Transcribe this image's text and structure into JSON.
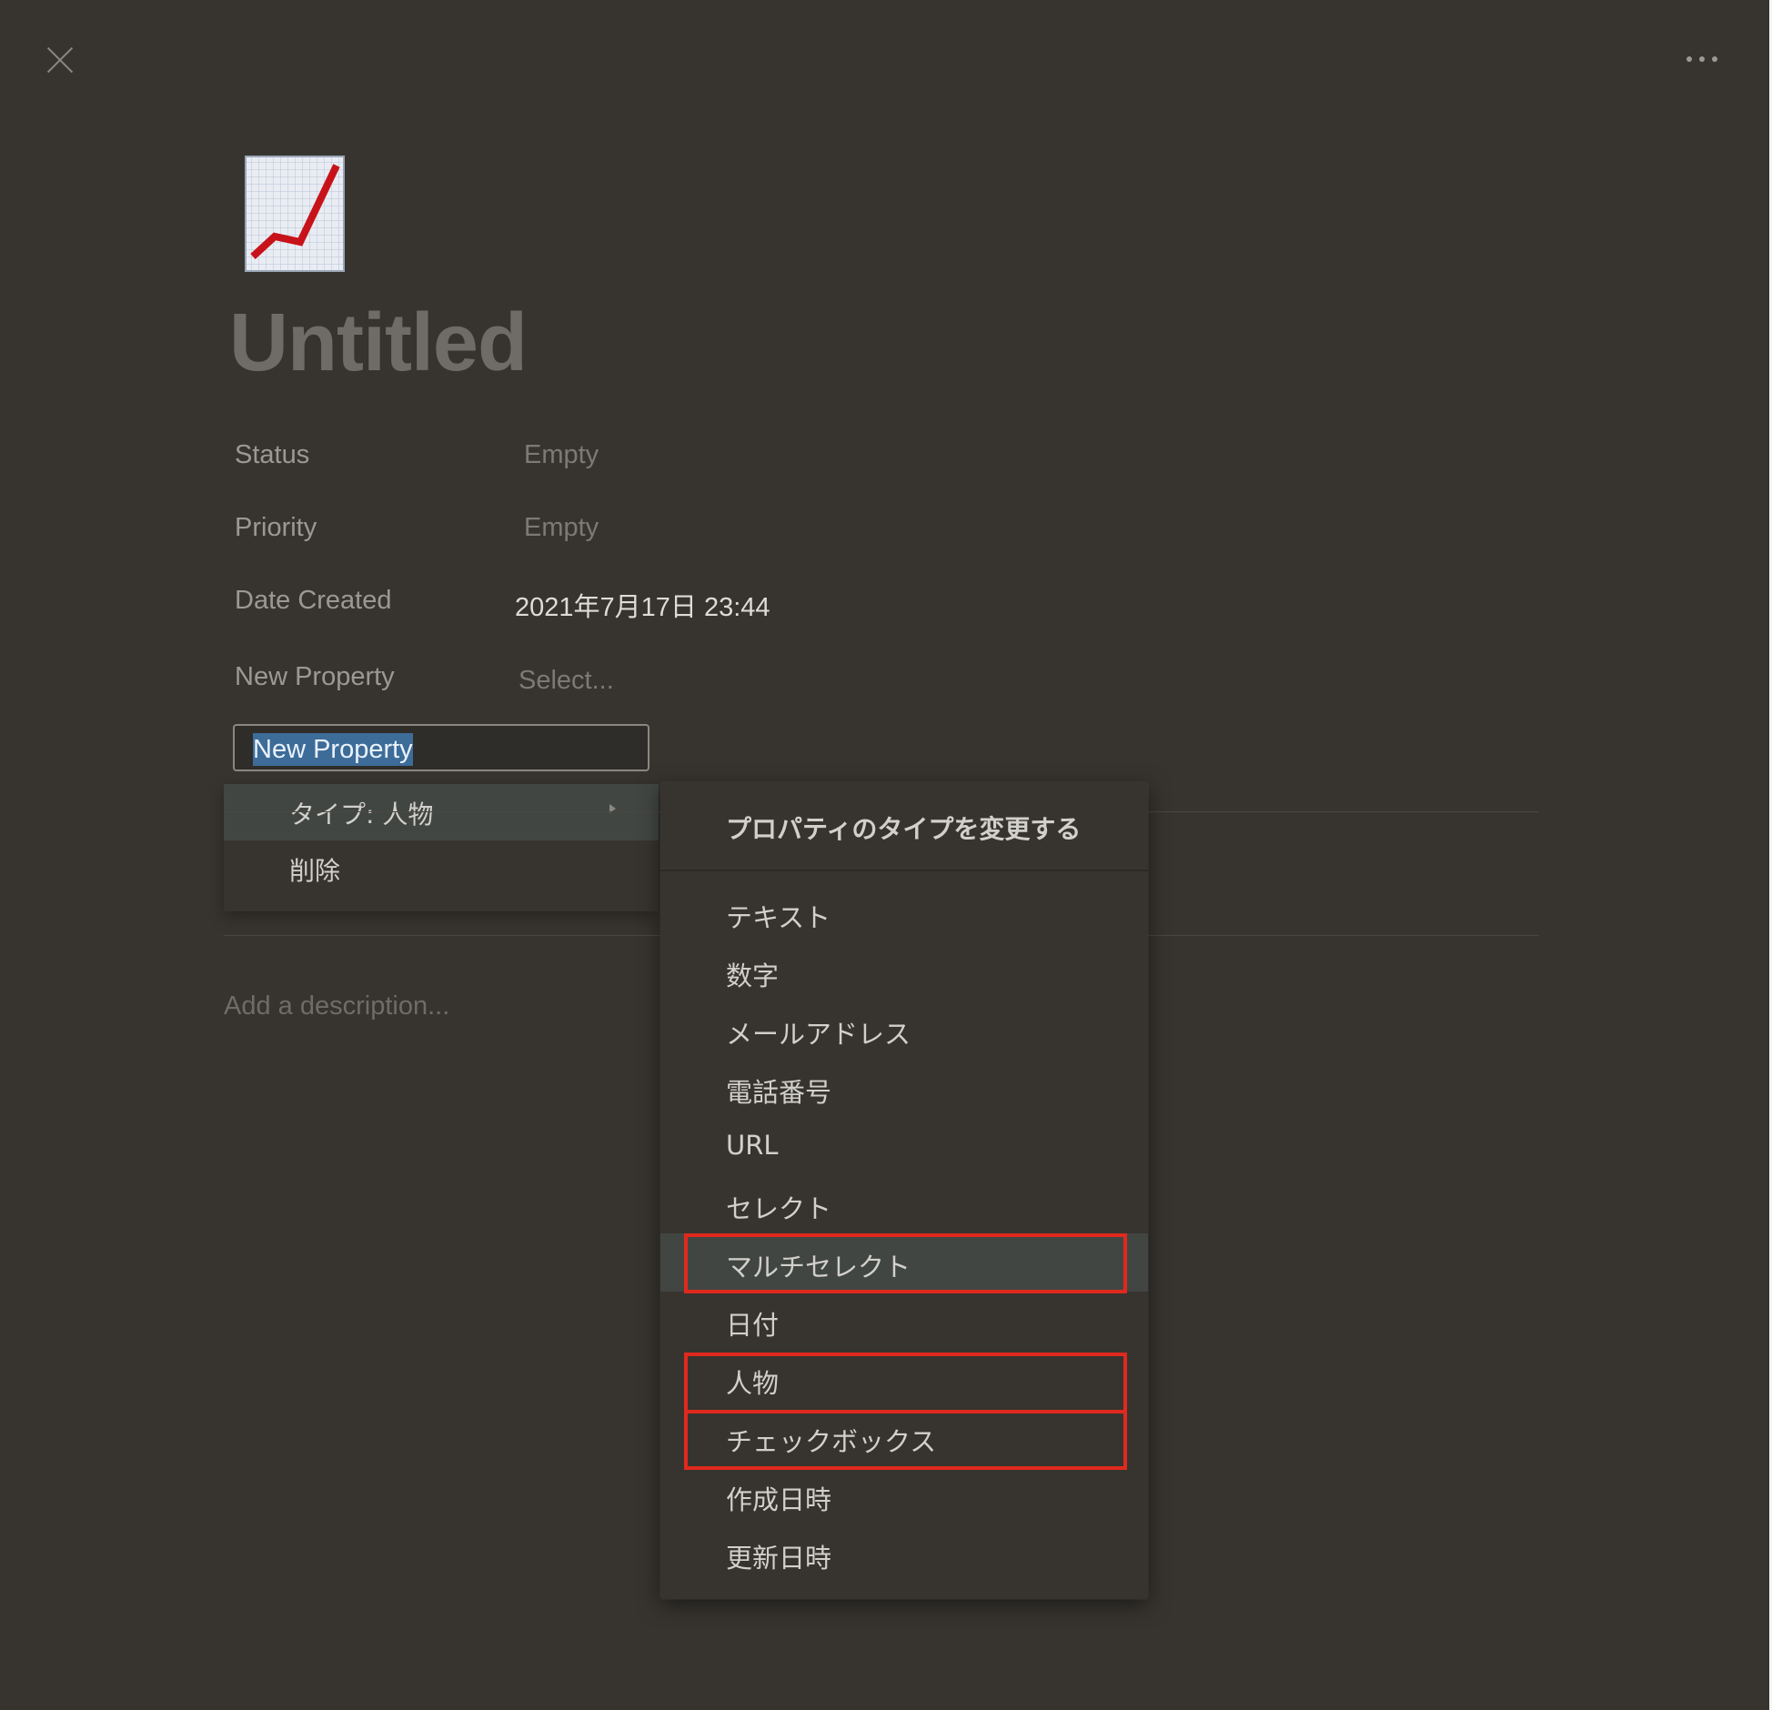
{
  "page": {
    "title": "Untitled",
    "icon": "chart-increasing-icon"
  },
  "properties": [
    {
      "name": "Status",
      "value": "Empty"
    },
    {
      "name": "Priority",
      "value": "Empty"
    },
    {
      "name": "Date Created",
      "value": "2021年7月17日 23:44"
    },
    {
      "name": "New Property",
      "value": "Select..."
    }
  ],
  "property_editor": {
    "name_value": "New Property",
    "menu": [
      {
        "label": "タイプ: 人物",
        "has_submenu": true
      },
      {
        "label": "削除"
      }
    ]
  },
  "description_placeholder": "Add a description...",
  "type_menu": {
    "title": "プロパティのタイプを変更する",
    "items": [
      "テキスト",
      "数字",
      "メールアドレス",
      "電話番号",
      "URL",
      "セレクト",
      "マルチセレクト",
      "日付",
      "人物",
      "チェックボックス",
      "作成日時",
      "更新日時"
    ],
    "hovered_item": "マルチセレクト",
    "highlighted_items": [
      "マルチセレクト",
      "人物",
      "チェックボックス"
    ]
  },
  "colors": {
    "background": "#37342f",
    "highlight_box": "#e0291e",
    "selection": "#3d6c99"
  }
}
